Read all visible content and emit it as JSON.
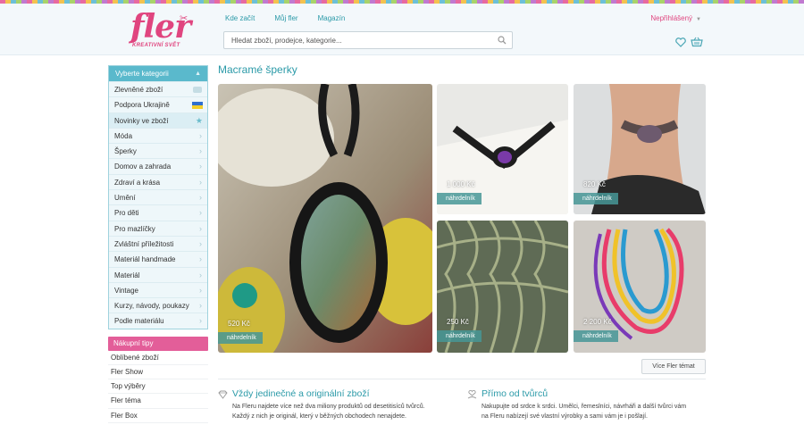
{
  "header": {
    "logo_text": "fler",
    "logo_subtitle": "KREATIVNÍ SVĚT",
    "nav": [
      "Kde začít",
      "Můj fler",
      "Magazín"
    ],
    "search_placeholder": "Hledat zboží, prodejce, kategorie...",
    "user_label": "Nepřihlášený",
    "icons": [
      "search-icon",
      "heart-icon",
      "cart-icon"
    ]
  },
  "sidebar": {
    "categories_header": "Vyberte kategorii",
    "categories": [
      "Zlevněné zboží",
      "Podpora Ukrajině",
      "Novinky ve zboží",
      "Móda",
      "Šperky",
      "Domov a zahrada",
      "Zdraví a krása",
      "Umění",
      "Pro děti",
      "Pro mazlíčky",
      "Zvláštní příležitosti",
      "Materiál handmade",
      "Materiál",
      "Vintage",
      "Kurzy, návody, poukazy",
      "Podle materiálu"
    ],
    "tips_header": "Nákupní tipy",
    "tips": [
      "Oblíbené zboží",
      "Fler Show",
      "Top výběry",
      "Fler téma",
      "Fler Box"
    ]
  },
  "main": {
    "title": "Macramé šperky",
    "products": [
      {
        "price": "520 Kč",
        "badge": "náhrdelník"
      },
      {
        "price": "1 000 Kč",
        "badge": "náhrdelník"
      },
      {
        "price": "820 Kč",
        "badge": "náhrdelník"
      },
      {
        "price": "250 Kč",
        "badge": "náhrdelník"
      },
      {
        "price": "2 200 Kč",
        "badge": "náhrdelník"
      }
    ],
    "more_button": "Více Fler témat"
  },
  "features": [
    {
      "title": "Vždy jedinečné a originální zboží",
      "lines": [
        "Na Fleru najdete více než dva miliony produktů od desetitisíců tvůrců.",
        "Každý z nich je originál, který v běžných obchodech nenajdete."
      ]
    },
    {
      "title": "Přímo od tvůrců",
      "lines": [
        "Nakupujte od srdce k srdci. Umělci, řemeslníci, návrháři a další tvůrci vám",
        "na Fleru nabízejí své vlastní výrobky a sami vám je i pošlají."
      ]
    }
  ],
  "colors": {
    "accent_teal": "#2b9aa8",
    "brand_pink": "#e0457f",
    "category_header": "#5ab9cc",
    "tips_header": "#e35e99"
  }
}
